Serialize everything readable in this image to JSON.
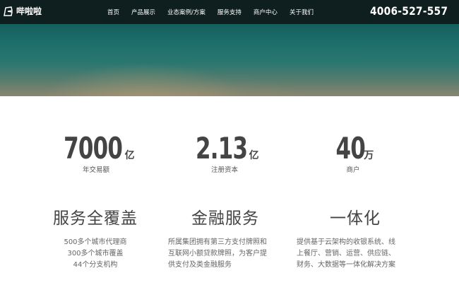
{
  "header": {
    "logo_text": "哔啦啦",
    "nav": [
      "首页",
      "产品展示",
      "业态案例/方案",
      "服务支持",
      "商户中心",
      "关于我们"
    ],
    "hotline": "4006-527-557"
  },
  "stats": [
    {
      "number": "7000",
      "unit": "亿",
      "caption": "年交易额"
    },
    {
      "number": "2.13",
      "unit": "亿",
      "caption": "注册资本"
    },
    {
      "number": "40",
      "unit": "万",
      "caption": "商户"
    }
  ],
  "features": [
    {
      "title": "服务全覆盖",
      "lines": [
        "500多个城市代理商",
        "300多个城市覆盖",
        "44个分支机构"
      ]
    },
    {
      "title": "金融服务",
      "lines": [
        "所属集团拥有第三方支付牌照和",
        "互联网小额贷款牌照，为客户提",
        "供支付及类金融服务"
      ]
    },
    {
      "title": "一体化",
      "lines": [
        "提供基于云架构的收银系统、线",
        "上餐厅、营销、运营、供应链、",
        "财务、大数据等一体化解决方案"
      ]
    }
  ]
}
